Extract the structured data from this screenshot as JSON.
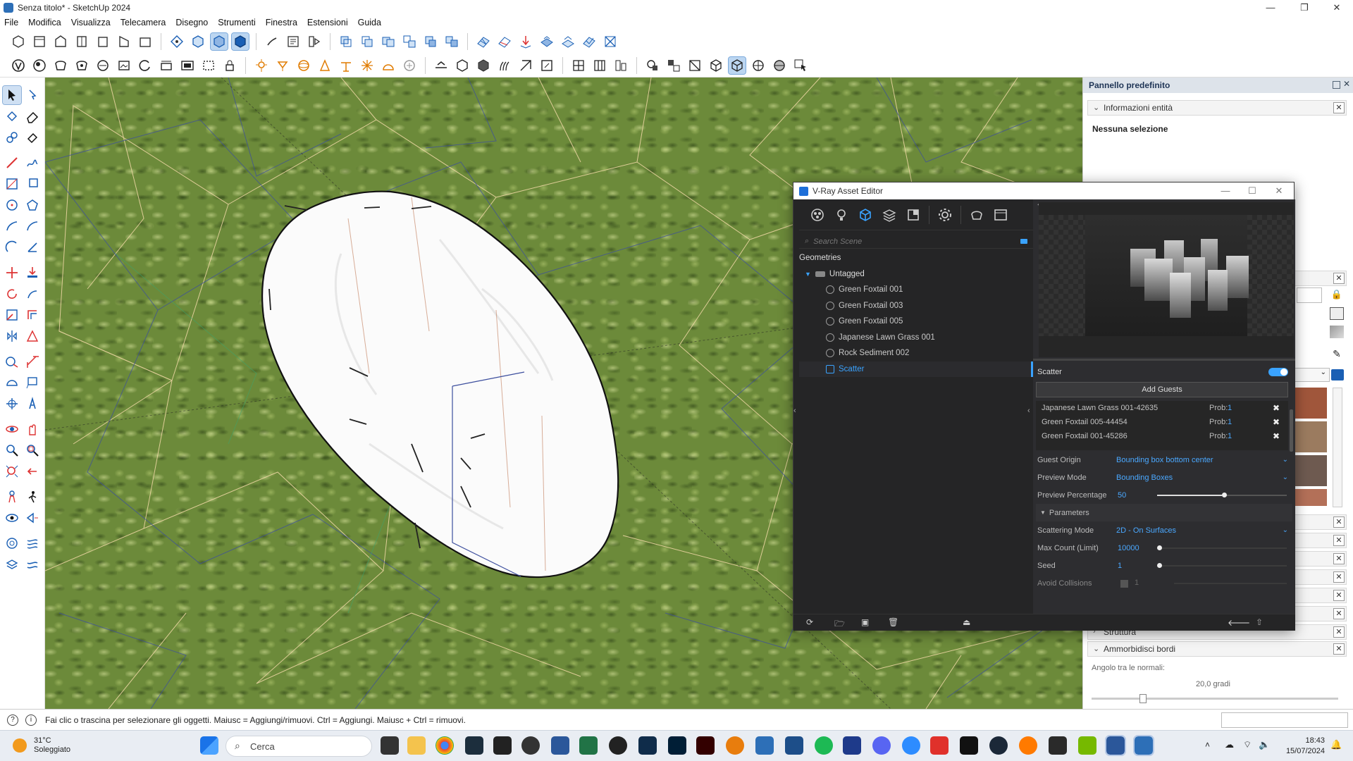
{
  "window": {
    "title": "Senza titolo* - SketchUp 2024",
    "controls": [
      "—",
      "❐",
      "✕"
    ]
  },
  "menu": [
    "File",
    "Modifica",
    "Visualizza",
    "Telecamera",
    "Disegno",
    "Strumenti",
    "Finestra",
    "Estensioni",
    "Guida"
  ],
  "tray": {
    "title": "Pannello predefinito",
    "entity_info": "Informazioni entità",
    "no_selection": "Nessuna selezione",
    "structure": "Struttura",
    "soften_edges": "Ammorbidisci bordi",
    "normals_angle_label": "Angolo tra le normali:",
    "normals_angle_value": "20,0  gradi",
    "normals_angle_fraction": 0.2
  },
  "vray": {
    "title": "V-Ray Asset Editor",
    "search_placeholder": "Search Scene",
    "geometries": "Geometries",
    "untagged": "Untagged",
    "items": [
      "Green Foxtail 001",
      "Green Foxtail 003",
      "Green Foxtail 005",
      "Japanese Lawn Grass 001",
      "Rock Sediment 002",
      "Scatter"
    ],
    "selected_item": "Scatter",
    "scatter_label": "Scatter",
    "add_guests": "Add Guests",
    "guests": [
      {
        "name": "Japanese Lawn Grass 001-42635",
        "prob_label": "Prob:",
        "prob": "1"
      },
      {
        "name": "Green Foxtail 005-44454",
        "prob_label": "Prob:",
        "prob": "1"
      },
      {
        "name": "Green Foxtail 001-45286",
        "prob_label": "Prob:",
        "prob": "1"
      }
    ],
    "guest_origin_label": "Guest Origin",
    "guest_origin_value": "Bounding box bottom center",
    "preview_mode_label": "Preview Mode",
    "preview_mode_value": "Bounding Boxes",
    "preview_percentage_label": "Preview Percentage",
    "preview_percentage_value": "50",
    "parameters_label": "Parameters",
    "scattering_mode_label": "Scattering Mode",
    "scattering_mode_value": "2D - On Surfaces",
    "max_count_label": "Max Count (Limit)",
    "max_count_value": "10000",
    "seed_label": "Seed",
    "seed_value": "1",
    "avoid_collisions_label": "Avoid Collisions",
    "avoid_collisions_value": "1"
  },
  "statusbar": {
    "hint": "Fai clic o trascina per selezionare gli oggetti. Maiusc = Aggiungi/rimuovi. Ctrl = Aggiungi. Maiusc + Ctrl = rimuovi."
  },
  "taskbar": {
    "temp": "31°C",
    "weather": "Soleggiato",
    "search_placeholder": "Cerca",
    "time": "18:43",
    "date": "15/07/2024"
  },
  "colors": {
    "accent": "#3aa3ff",
    "vray_bg": "#252526",
    "grass": "#6c8a3a"
  }
}
